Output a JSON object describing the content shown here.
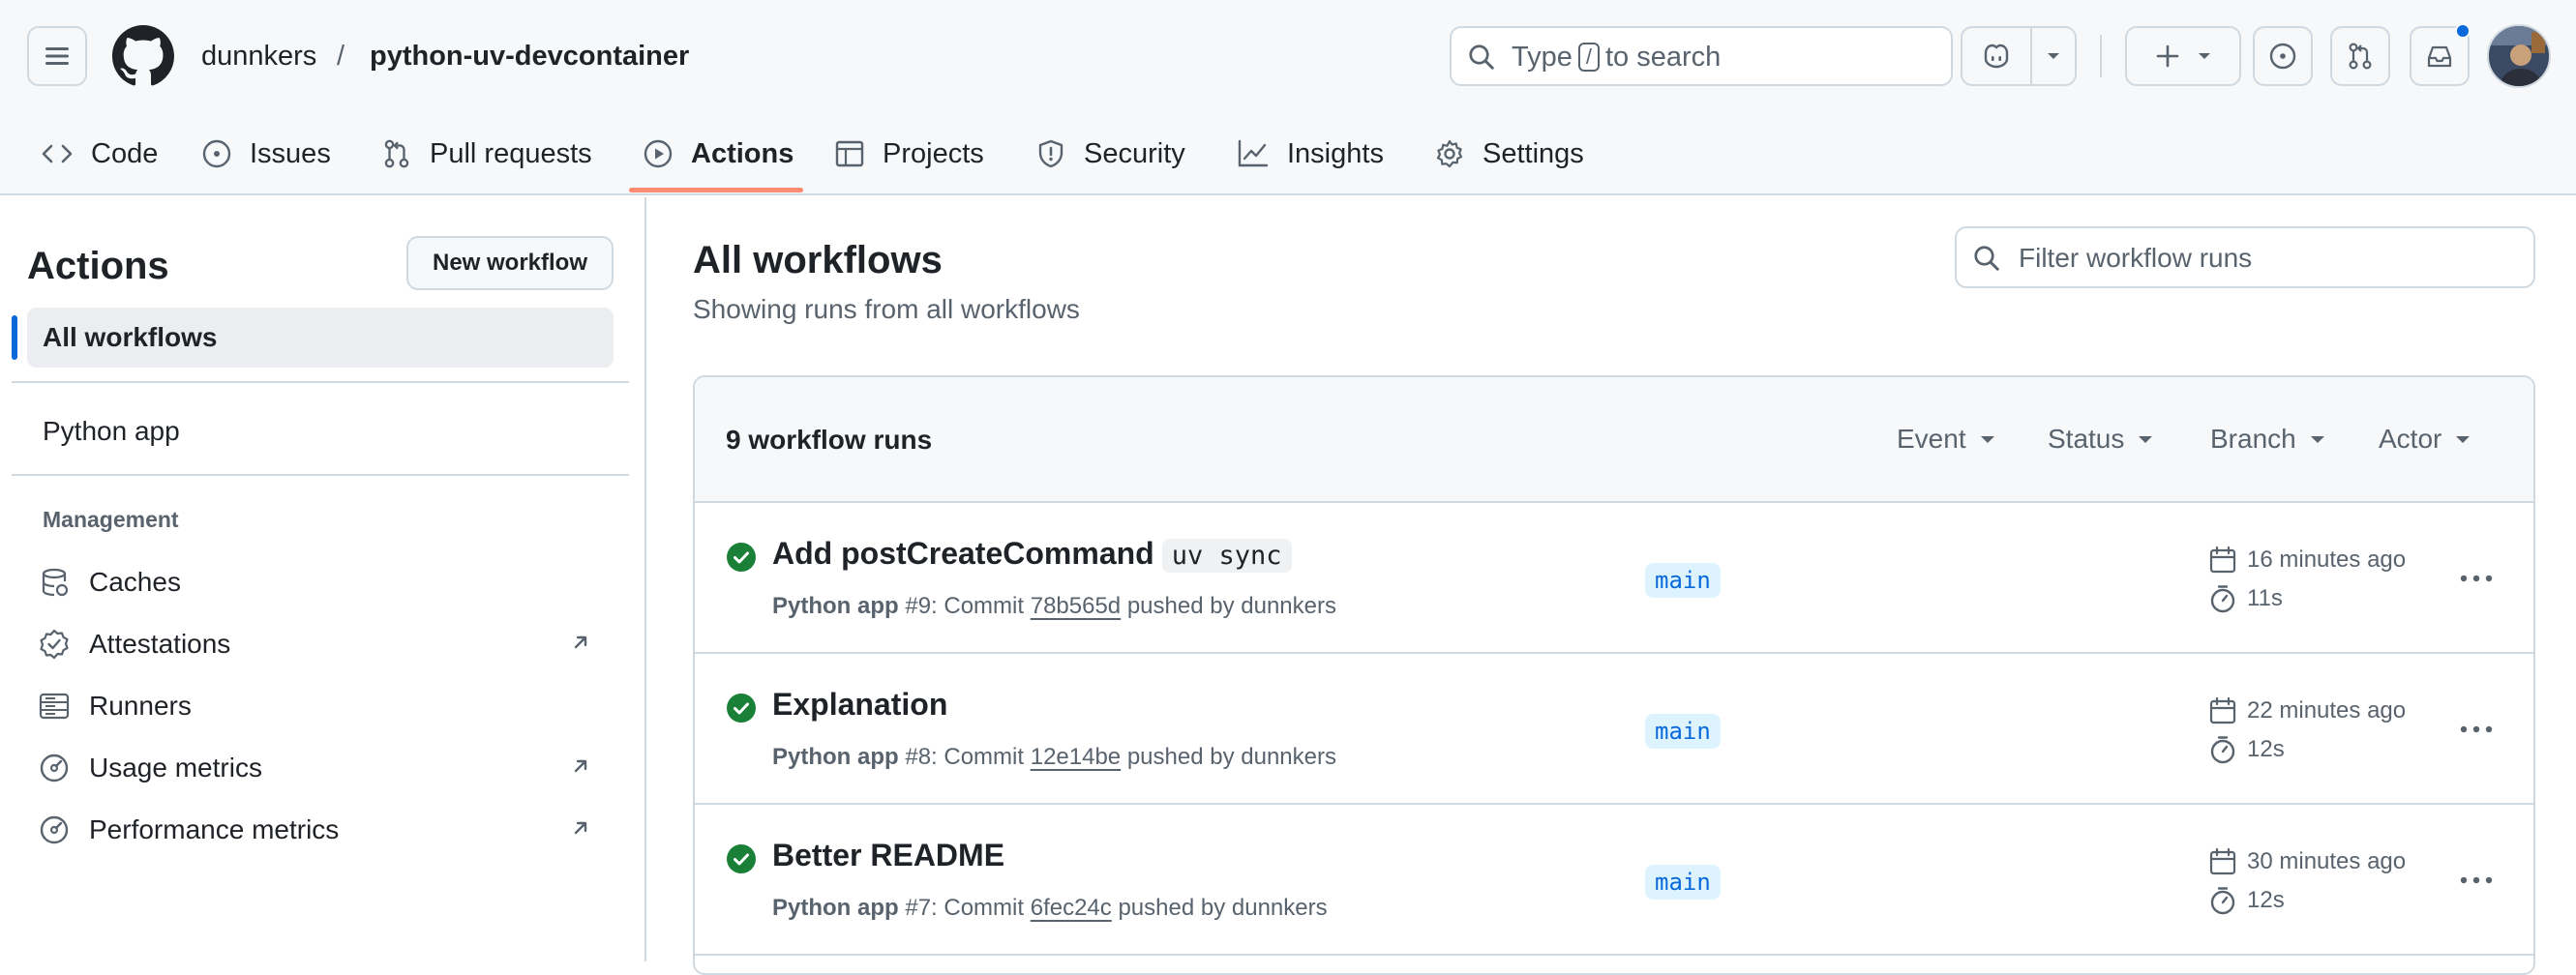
{
  "header": {
    "owner": "dunnkers",
    "separator": "/",
    "repo": "python-uv-devcontainer",
    "search": {
      "prefix": "Type",
      "key": "/",
      "suffix": "to search"
    }
  },
  "tabs": [
    {
      "label": "Code",
      "icon": "code-icon"
    },
    {
      "label": "Issues",
      "icon": "issue-opened-icon"
    },
    {
      "label": "Pull requests",
      "icon": "git-pull-request-icon"
    },
    {
      "label": "Actions",
      "icon": "play-icon",
      "selected": true
    },
    {
      "label": "Projects",
      "icon": "table-icon"
    },
    {
      "label": "Security",
      "icon": "shield-icon"
    },
    {
      "label": "Insights",
      "icon": "graph-icon"
    },
    {
      "label": "Settings",
      "icon": "gear-icon"
    }
  ],
  "sidebar": {
    "title": "Actions",
    "new_workflow": "New workflow",
    "all_workflows": "All workflows",
    "workflows": [
      "Python app"
    ],
    "management_heading": "Management",
    "management": [
      {
        "label": "Caches",
        "icon": "database-icon",
        "external": false
      },
      {
        "label": "Attestations",
        "icon": "verified-icon",
        "external": true
      },
      {
        "label": "Runners",
        "icon": "server-icon",
        "external": false
      },
      {
        "label": "Usage metrics",
        "icon": "meter-icon",
        "external": true
      },
      {
        "label": "Performance metrics",
        "icon": "meter-icon",
        "external": true
      }
    ]
  },
  "main": {
    "title": "All workflows",
    "subtitle": "Showing runs from all workflows",
    "filter_placeholder": "Filter workflow runs",
    "runs_count": "9 workflow runs",
    "filters": [
      "Event",
      "Status",
      "Branch",
      "Actor"
    ],
    "runs": [
      {
        "title": "Add postCreateCommand",
        "code": "uv sync",
        "workflow": "Python app",
        "meta_number": "#9: Commit",
        "commit": "78b565d",
        "meta_suffix": "pushed by dunnkers",
        "branch": "main",
        "when": "16 minutes ago",
        "duration": "11s"
      },
      {
        "title": "Explanation",
        "code": "",
        "workflow": "Python app",
        "meta_number": "#8: Commit",
        "commit": "12e14be",
        "meta_suffix": "pushed by dunnkers",
        "branch": "main",
        "when": "22 minutes ago",
        "duration": "12s"
      },
      {
        "title": "Better README",
        "code": "",
        "workflow": "Python app",
        "meta_number": "#7: Commit",
        "commit": "6fec24c",
        "meta_suffix": "pushed by dunnkers",
        "branch": "main",
        "when": "30 minutes ago",
        "duration": "12s"
      }
    ]
  },
  "colors": {
    "accent": "#0969da",
    "success": "#1a7f37",
    "tab_underline": "#fd8c73",
    "border": "#d1d9e0",
    "muted": "#59636e"
  }
}
